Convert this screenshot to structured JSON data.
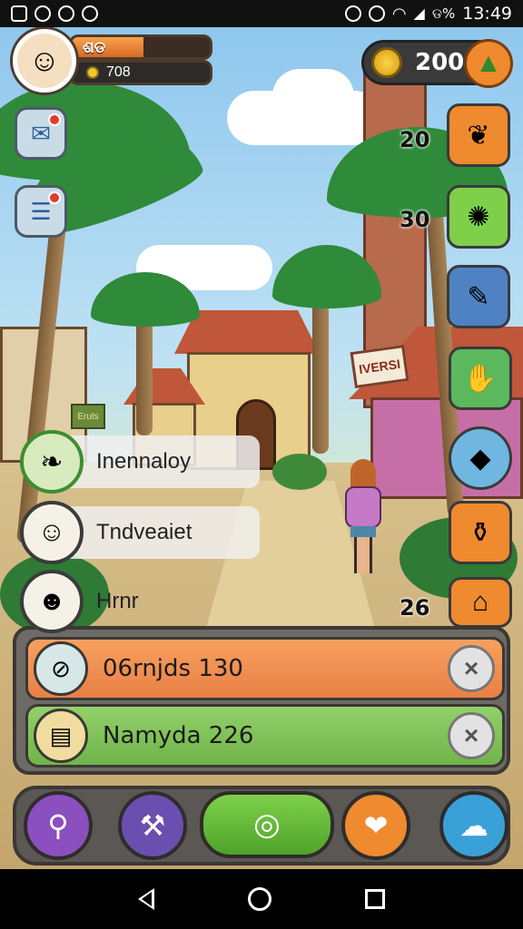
{
  "status_bar": {
    "left_icons": [
      "gallery-icon",
      "notification-icon",
      "chat-icon",
      "message-icon"
    ],
    "right_icons": [
      "alarm-icon",
      "silent-icon",
      "wifi-icon",
      "signal-icon"
    ],
    "battery_text": "ଡ%",
    "time": "13:49"
  },
  "player": {
    "level_label": "ଶଡ",
    "xp_fill_percent": 52,
    "coins_value": "708",
    "avatar_icon": "player-avatar"
  },
  "currency": {
    "value": "200",
    "icon": "gold-coin-icon",
    "add_icon": "arrow-up-icon"
  },
  "left_buttons": [
    {
      "icon": "mail-icon",
      "badge": true
    },
    {
      "icon": "news-icon",
      "badge": true
    }
  ],
  "right_buttons": [
    {
      "icon": "dog-icon",
      "count": "20",
      "color": "#ef8a2e"
    },
    {
      "icon": "lightbulb-icon",
      "count": "30",
      "color": "#7ed04b"
    },
    {
      "icon": "tools-icon",
      "count": "",
      "color": "#4f82c2"
    },
    {
      "icon": "glove-icon",
      "count": "",
      "color": "#5cb85c"
    },
    {
      "icon": "gem-icon",
      "count": "",
      "color": "#6fb6e0"
    },
    {
      "icon": "basket-icon",
      "count": "",
      "color": "#ef8a2e"
    },
    {
      "icon": "house-icon",
      "count": "26",
      "color": "#ef8a2e"
    }
  ],
  "quests": [
    {
      "label": "Inennaloy",
      "icon": "bread-icon"
    },
    {
      "label": "Tndveaiet",
      "icon": "girl-avatar-icon"
    },
    {
      "label": "Hrnr",
      "icon": "cat-icon"
    }
  ],
  "panel_rows": [
    {
      "text": "06rnjds 130",
      "icon": "compass-icon",
      "close": "×"
    },
    {
      "text": "Namyda 226",
      "icon": "books-icon",
      "close": "×"
    }
  ],
  "toolbar": {
    "buttons": [
      {
        "icon": "search-icon",
        "color": "#8b4fc0"
      },
      {
        "icon": "crafting-icon",
        "color": "#6a4fb0"
      },
      {
        "icon": "chat-bubble-icon",
        "color": "#4ea32a"
      },
      {
        "icon": "pet-icon",
        "color": "#ef8a2e"
      },
      {
        "icon": "ghost-icon",
        "color": "#3aa0d8"
      }
    ]
  },
  "scene": {
    "signpost": "Eruts",
    "shop_sign": "IVERSI"
  },
  "colors": {
    "accent_orange": "#ef8a2e",
    "accent_green": "#6fb44a",
    "panel_gray": "#6e6a66"
  }
}
